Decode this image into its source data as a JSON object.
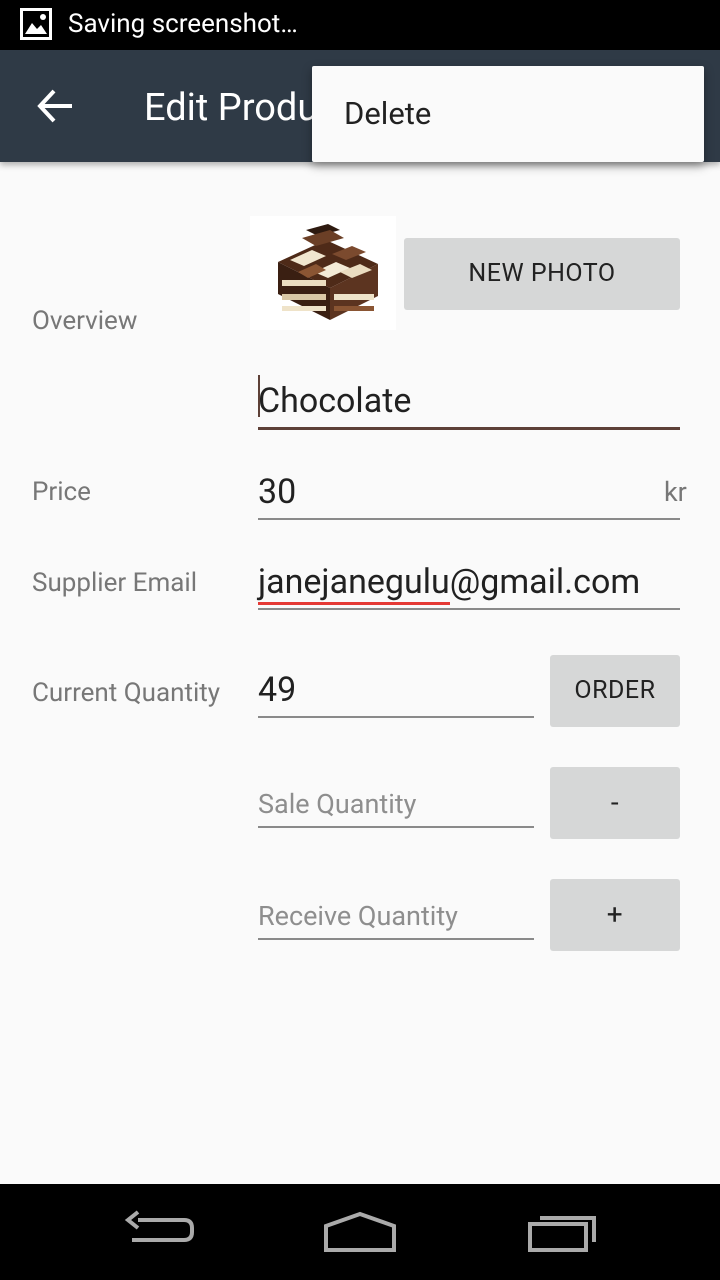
{
  "status_bar": {
    "text": "Saving screenshot…",
    "icon": "image-icon"
  },
  "app_bar": {
    "title": "Edit Product",
    "back_icon": "back-arrow-icon",
    "color": "#2f3a46"
  },
  "overflow_menu": {
    "items": [
      {
        "label": "Delete"
      }
    ]
  },
  "form": {
    "overview_label": "Overview",
    "new_photo_label": "NEW PHOTO",
    "product_name": "Chocolate",
    "price_label": "Price",
    "price_value": "30",
    "price_suffix": "kr",
    "supplier_email_label": "Supplier Email",
    "supplier_email_misspelled": "janejanegulu",
    "supplier_email_rest": "@gmail.com",
    "current_quantity_label": "Current Quantity",
    "current_quantity_value": "49",
    "order_label": "ORDER",
    "sale_quantity_placeholder": "Sale Quantity",
    "decrease_label": "-",
    "receive_quantity_placeholder": "Receive Quantity",
    "increase_label": "+"
  },
  "nav_bar": {
    "icons": [
      "back-nav-icon",
      "home-nav-icon",
      "recents-nav-icon"
    ]
  }
}
